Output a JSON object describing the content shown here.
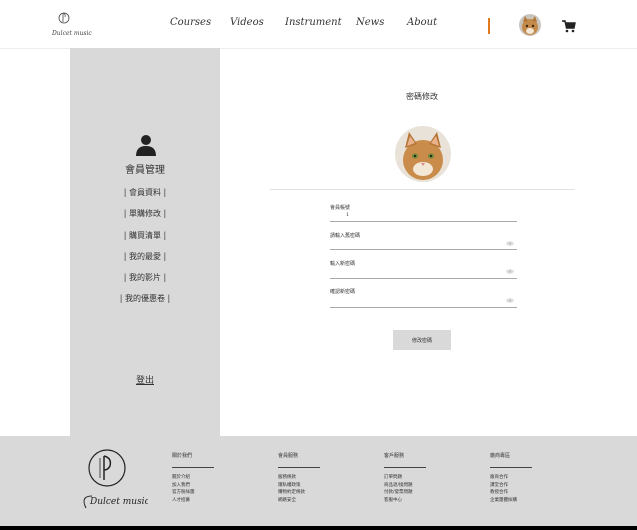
{
  "header": {
    "brand_text": "Dulcet music",
    "nav": [
      "Courses",
      "Videos",
      "Instrument",
      "News",
      "About"
    ],
    "divider_color": "#e07a1f",
    "avatar_icon": "cat-avatar-icon",
    "cart_icon": "cart-icon"
  },
  "sidebar": {
    "title": "會員管理",
    "items": [
      "| 會員資料 |",
      "| 單購修改 |",
      "| 購買清單 |",
      "| 我的最愛 |",
      "| 我的影片 |",
      "| 我的優惠卷 |"
    ],
    "logout": "登出"
  },
  "main": {
    "title": "密碼修改",
    "fields": [
      {
        "label": "會員帳號",
        "value": "1"
      },
      {
        "label": "請輸入舊密碼",
        "value": ""
      },
      {
        "label": "輸入新密碼",
        "value": ""
      },
      {
        "label": "確認新密碼",
        "value": ""
      }
    ],
    "submit_label": "修改密碼"
  },
  "footer": {
    "brand_text": "Dulcet music",
    "columns": [
      {
        "heading": "關於我們",
        "links": [
          "關於介紹",
          "加入我們",
          "官方粉絲團",
          "人才招募"
        ]
      },
      {
        "heading": "會員服務",
        "links": [
          "服務條款",
          "隱私權政策",
          "購物約定條款",
          "網路安全"
        ]
      },
      {
        "heading": "客戶服務",
        "links": [
          "訂單問題",
          "商品退/換問題",
          "付款/發票問題",
          "客服中心"
        ]
      },
      {
        "heading": "廠商專區",
        "links": [
          "廠商合作",
          "課堂合作",
          "教授合作",
          "企業團體採購"
        ]
      }
    ]
  }
}
